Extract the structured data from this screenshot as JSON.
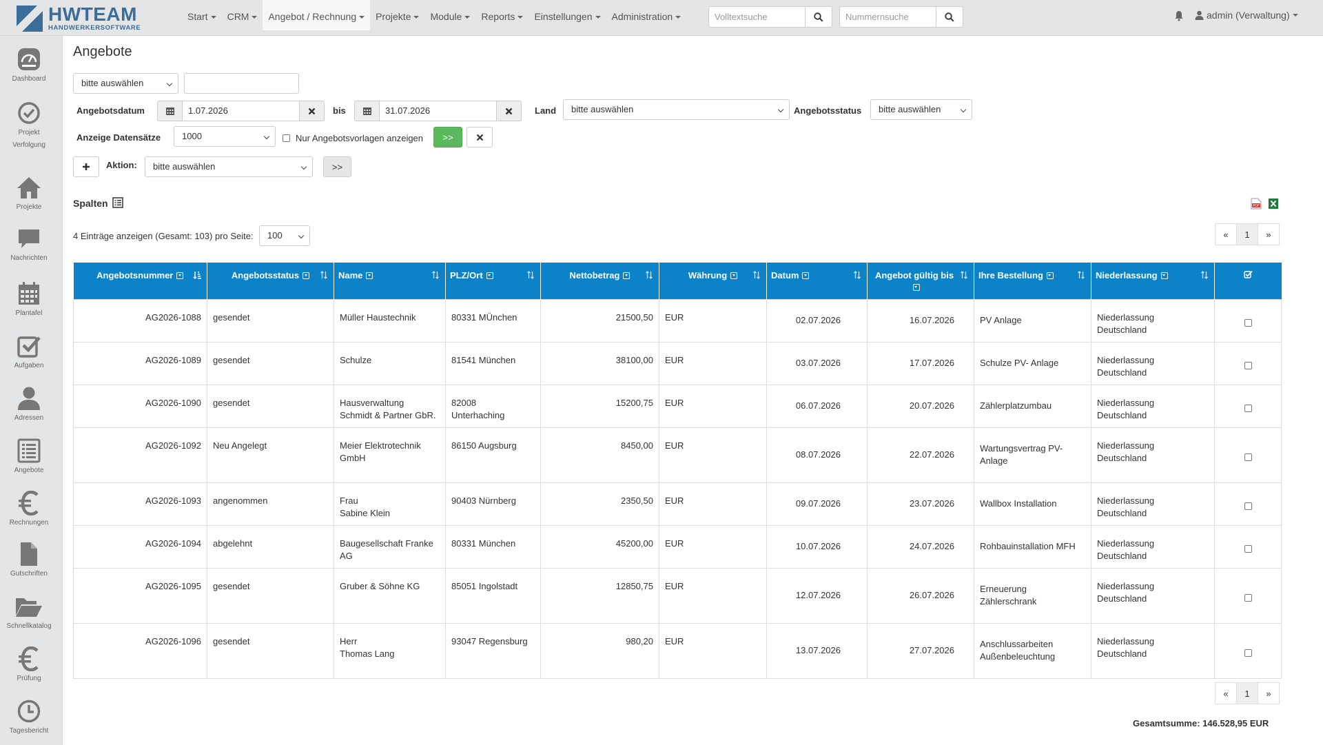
{
  "app": {
    "logo_title": "HWTEAM",
    "logo_subtitle": "HANDWERKERSOFTWARE"
  },
  "nav": {
    "items": [
      {
        "label": "Start"
      },
      {
        "label": "CRM"
      },
      {
        "label": "Angebot / Rechnung"
      },
      {
        "label": "Projekte"
      },
      {
        "label": "Module"
      },
      {
        "label": "Reports"
      },
      {
        "label": "Einstellungen"
      },
      {
        "label": "Administration"
      }
    ],
    "active_index": 2,
    "fulltext_placeholder": "Volltextsuche",
    "number_placeholder": "Nummernsuche",
    "user": "admin (Verwaltung)"
  },
  "sidebar": {
    "items": [
      {
        "label": "Dashboard",
        "icon": "dashboard-icon"
      },
      {
        "label": "Projekt",
        "label2": "Verfolgung",
        "icon": "check-circle-icon"
      },
      {
        "label": "Projekte",
        "icon": "home-icon"
      },
      {
        "label": "Nachrichten",
        "icon": "message-icon"
      },
      {
        "label": "Plantafel",
        "icon": "calendar-icon"
      },
      {
        "label": "Aufgaben",
        "icon": "task-check-icon"
      },
      {
        "label": "Adressen",
        "icon": "user-icon"
      },
      {
        "label": "Angebote",
        "icon": "list-icon"
      },
      {
        "label": "Rechnungen",
        "icon": "euro-icon"
      },
      {
        "label": "Gutschriften",
        "icon": "file-icon"
      },
      {
        "label": "Schnellkatalog",
        "icon": "folder-icon"
      },
      {
        "label": "Prüfung",
        "icon": "euro-icon"
      },
      {
        "label": "Tagesbericht",
        "icon": "clock-icon"
      }
    ]
  },
  "page": {
    "title": "Angebote"
  },
  "filters": {
    "top_select": "bitte auswählen",
    "top_input": "",
    "date_label": "Angebotsdatum",
    "date_from": "1.07.2026",
    "bis_label": "bis",
    "date_to": "31.07.2026",
    "land_label": "Land",
    "land_value": "bitte auswählen",
    "status_label": "Angebotsstatus",
    "status_value": "bitte auswählen",
    "records_label": "Anzeige Datensätze",
    "records_value": "1000",
    "templates_label": "Nur Angebotsvorlagen anzeigen",
    "go_label": ">>",
    "action_label": "Aktion:",
    "action_value": "bitte auswählen",
    "action_go_label": ">>"
  },
  "list": {
    "columns_label": "Spalten",
    "entries_text": "4 Einträge anzeigen (Gesamt: 103) pro Seite:",
    "per_page": "100",
    "pager": {
      "prev": "«",
      "page": "1",
      "next": "»"
    },
    "headers": [
      "Angebotsnummer",
      "Angebotsstatus",
      "Name",
      "PLZ/Ort",
      "Nettobetrag",
      "Währung",
      "Datum",
      "Angebot gültig bis",
      "Ihre Bestellung",
      "Niederlassung"
    ],
    "rows": [
      {
        "nr": "AG2026-1088",
        "status": "gesendet",
        "name1": "Müller Haustechnik",
        "name2": "",
        "plz1": "80331 MÜnchen",
        "plz2": "",
        "netto": "21500,50",
        "cur": "EUR",
        "datum": "02.07.2026",
        "gueltig": "16.07.2026",
        "best1": "PV Anlage",
        "best2": "",
        "nl1": "Niederlassung",
        "nl2": "Deutschland"
      },
      {
        "nr": "AG2026-1089",
        "status": "gesendet",
        "name1": "Schulze",
        "name2": "",
        "plz1": "81541 München",
        "plz2": "",
        "netto": "38100,00",
        "cur": "EUR",
        "datum": "03.07.2026",
        "gueltig": "17.07.2026",
        "best1": "Schulze PV- Anlage",
        "best2": "",
        "nl1": "Niederlassung",
        "nl2": "Deutschland"
      },
      {
        "nr": "AG2026-1090",
        "status": "gesendet",
        "name1": "Hausverwaltung",
        "name2": "Schmidt & Partner GbR.",
        "plz1": "82008",
        "plz2": "Unterhaching",
        "netto": "15200,75",
        "cur": "EUR",
        "datum": "06.07.2026",
        "gueltig": "20.07.2026",
        "best1": "Zählerplatzumbau",
        "best2": "",
        "nl1": "Niederlassung",
        "nl2": "Deutschland"
      },
      {
        "nr": "AG2026-1092",
        "status": "Neu Angelegt",
        "name1": "Meier Elektrotechnik",
        "name2": "GmbH",
        "plz1": "86150 Augsburg",
        "plz2": "",
        "netto": "8450,00",
        "cur": "EUR",
        "datum": "08.07.2026",
        "gueltig": "22.07.2026",
        "best1": "Wartungsvertrag PV-",
        "best2": "Anlage",
        "nl1": "Niederlassung",
        "nl2": "Deutschland"
      },
      {
        "nr": "AG2026-1093",
        "status": "angenommen",
        "name1": "Frau",
        "name2": "Sabine Klein",
        "plz1": "90403 Nürnberg",
        "plz2": "",
        "netto": "2350,50",
        "cur": "EUR",
        "datum": "09.07.2026",
        "gueltig": "23.07.2026",
        "best1": "Wallbox Installation",
        "best2": "",
        "nl1": "Niederlassung",
        "nl2": "Deutschland"
      },
      {
        "nr": "AG2026-1094",
        "status": "abgelehnt",
        "name1": "Baugesellschaft Franke",
        "name2": "AG",
        "plz1": "80331 München",
        "plz2": "",
        "netto": "45200,00",
        "cur": "EUR",
        "datum": "10.07.2026",
        "gueltig": "24.07.2026",
        "best1": "Rohbauinstallation MFH",
        "best2": "",
        "nl1": "Niederlassung",
        "nl2": "Deutschland"
      },
      {
        "nr": "AG2026-1095",
        "status": "gesendet",
        "name1": "Gruber & Söhne KG",
        "name2": "",
        "plz1": "85051 Ingolstadt",
        "plz2": "",
        "netto": "12850,75",
        "cur": "EUR",
        "datum": "12.07.2026",
        "gueltig": "26.07.2026",
        "best1": "Erneuerung",
        "best2": "Zählerschrank",
        "nl1": "Niederlassung",
        "nl2": "Deutschland"
      },
      {
        "nr": "AG2026-1096",
        "status": "gesendet",
        "name1": "Herr",
        "name2": "Thomas Lang",
        "plz1": "93047 Regensburg",
        "plz2": "",
        "netto": "980,20",
        "cur": "EUR",
        "datum": "13.07.2026",
        "gueltig": "27.07.2026",
        "best1": "Anschlussarbeiten",
        "best2": "Außenbeleuchtung",
        "nl1": "Niederlassung",
        "nl2": "Deutschland"
      }
    ],
    "total": "Gesamtsumme: 146.528,95 EUR"
  },
  "colors": {
    "header_blue": "#0c82c9",
    "go_green": "#5cb85c",
    "logo_blue": "#3a6d9a"
  }
}
